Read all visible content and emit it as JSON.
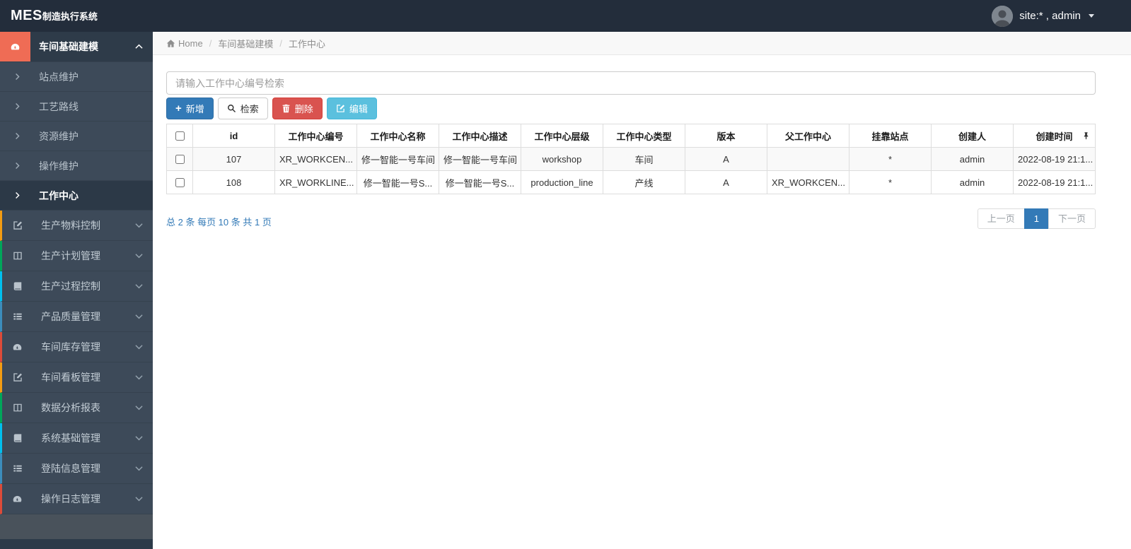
{
  "navbar": {
    "logo_bold": "MES",
    "logo_rest": "制造执行系统",
    "user_label": "site:* , admin"
  },
  "sidebar": {
    "active_parent": {
      "label": "车间基础建模",
      "icon": "dashboard-icon",
      "accent": "#ef6c55"
    },
    "submenu": [
      "站点维护",
      "工艺路线",
      "资源维护",
      "操作维护",
      "工作中心"
    ],
    "submenu_active_index": 4,
    "items": [
      {
        "label": "生产物料控制",
        "icon": "edit-icon",
        "accent": "#f39c12"
      },
      {
        "label": "生产计划管理",
        "icon": "columns-icon",
        "accent": "#00a65a"
      },
      {
        "label": "生产过程控制",
        "icon": "book-icon",
        "accent": "#00c0ef"
      },
      {
        "label": "产品质量管理",
        "icon": "list-icon",
        "accent": "#3c8dbc"
      },
      {
        "label": "车间库存管理",
        "icon": "dashboard-icon",
        "accent": "#dd4b39"
      },
      {
        "label": "车间看板管理",
        "icon": "edit-icon",
        "accent": "#f39c12"
      },
      {
        "label": "数据分析报表",
        "icon": "columns-icon",
        "accent": "#00a65a"
      },
      {
        "label": "系统基础管理",
        "icon": "book-icon",
        "accent": "#00c0ef"
      },
      {
        "label": "登陆信息管理",
        "icon": "list-icon",
        "accent": "#3c8dbc"
      },
      {
        "label": "操作日志管理",
        "icon": "dashboard-icon",
        "accent": "#dd4b39"
      }
    ]
  },
  "breadcrumb": {
    "separator": "/",
    "items": [
      "Home",
      "车间基础建模",
      "工作中心"
    ]
  },
  "toolbar": {
    "search_placeholder": "请输入工作中心编号检索",
    "search_value": "",
    "add_label": "新增",
    "search_label": "检索",
    "delete_label": "删除",
    "edit_label": "编辑"
  },
  "table": {
    "headers": [
      "id",
      "工作中心编号",
      "工作中心名称",
      "工作中心描述",
      "工作中心层级",
      "工作中心类型",
      "版本",
      "父工作中心",
      "挂靠站点",
      "创建人",
      "创建时间"
    ],
    "rows": [
      [
        "107",
        "XR_WORKCEN...",
        "修一智能一号车间",
        "修一智能一号车间",
        "workshop",
        "车间",
        "A",
        "",
        "*",
        "admin",
        "2022-08-19 21:1..."
      ],
      [
        "108",
        "XR_WORKLINE...",
        "修一智能一号S...",
        "修一智能一号S...",
        "production_line",
        "产线",
        "A",
        "XR_WORKCEN...",
        "*",
        "admin",
        "2022-08-19 21:1..."
      ]
    ]
  },
  "pagination": {
    "summary": "总 2 条  每页 10 条  共 1 页",
    "prev_label": "上一页",
    "current_page": "1",
    "next_label": "下一页"
  },
  "colors": {
    "navbar_bg": "#232d3b",
    "sidebar_bg": "#3d4a59",
    "active_item_bg": "#2e3b49",
    "active_icon_bg": "#ef6c55",
    "primary": "#337ab7",
    "danger": "#d9534f",
    "info": "#5bc0de"
  }
}
